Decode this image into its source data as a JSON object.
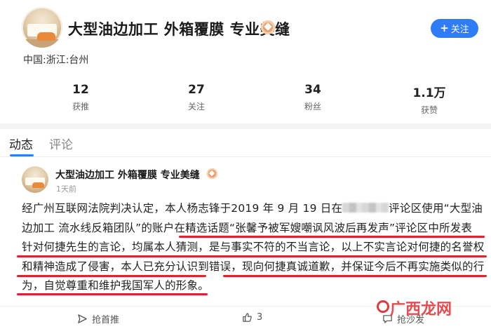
{
  "profile": {
    "name": "大型油边加工 外箱覆膜 专业美缝",
    "location": "中国:浙江:台州",
    "follow_label": "关注",
    "follow_symbol": "+",
    "stats": [
      {
        "value": "12",
        "label": "获推"
      },
      {
        "value": "27",
        "label": "关注"
      },
      {
        "value": "34",
        "label": "粉丝"
      },
      {
        "value": "1.1万",
        "label": "获赞"
      }
    ]
  },
  "tabs": [
    {
      "label": "动态",
      "active": true
    },
    {
      "label": "评论",
      "active": false
    }
  ],
  "post": {
    "author": "大型油边加工 外箱覆膜 专业美缝",
    "time": "1天前",
    "body": {
      "l1a": "经广州互联网法院判决认定，本人杨志锋于2019 年 9 月 19 日在",
      "l1b": "评论区使用“大型油",
      "l2": "边加工 流水线反箱团队”的账户在精选话题“张馨予被军嫂嘲讽风波后再发声”评论区中所发表",
      "l3": "针对何捷先生的言论，均属本人猜测，是与事实不符的不当言论，以上不实言论对何捷的名誉权",
      "l4": "和精神造成了侵害，本人已充分认识到错误，现向何捷真诚道歉，并保证今后不再实施类似的行",
      "l5": "为，自觉尊重和维护我国军人的形象。"
    },
    "actions": {
      "recommend": "抢首推",
      "likes": "3",
      "comment": "抢沙发"
    }
  },
  "watermark": "广西龙网",
  "colors": {
    "accent": "#2f7df6",
    "underline_red": "#d9252b",
    "badge": "#e9a071"
  }
}
